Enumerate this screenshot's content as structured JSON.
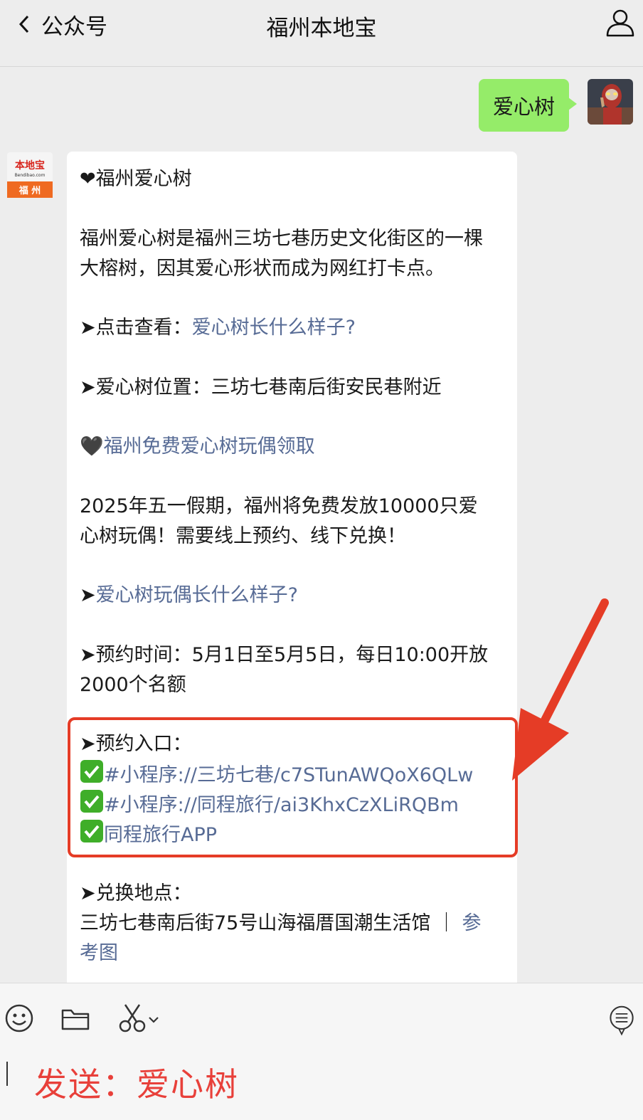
{
  "nav": {
    "back_label": "公众号",
    "title": "福州本地宝"
  },
  "outgoing": {
    "text": "爱心树"
  },
  "official_avatar": {
    "top_text": "本地宝",
    "sub_text": "Bendibao.com",
    "city_text": "福 州"
  },
  "message": {
    "heading": "❤福州爱心树",
    "intro_1": "福州爱心树是福州三坊七巷历史文化街区的一棵",
    "intro_2": "大榕树，因其爱心形状而成为网红打卡点。",
    "view_prefix": "➤点击查看：",
    "view_link": "爱心树长什么样子?",
    "location": "➤爱心树位置：三坊七巷南后街安民巷附近",
    "free_heart": "🖤",
    "free_link": "福州免费爱心树玩偶领取",
    "release_1": "2025年五一假期，福州将免费发放10000只爱",
    "release_2": "心树玩偶！需要线上预约、线下兑换！",
    "doll_prefix": "➤",
    "doll_link": "爱心树玩偶长什么样子?",
    "time_1": "➤预约时间：5月1日至5月5日，每日10:00开放",
    "time_2": "2000个名额",
    "entry_label": "➤预约入口：",
    "entry_1": "#小程序://三坊七巷/c7STunAWQoX6QLw",
    "entry_2": "#小程序://同程旅行/ai3KhxCzXLiRQBm",
    "entry_3": "同程旅行APP",
    "exchange_label": "➤兑换地点：",
    "exchange_addr": "三坊七巷南后街75号山海福厝国潮生活馆 ｜ ",
    "exchange_link_1": "参",
    "exchange_link_2": "考图"
  },
  "input": {
    "text": "发送：爱心树"
  },
  "colors": {
    "link": "#576b95",
    "outgoing_bubble": "#95ec69",
    "highlight": "#e53c26",
    "check": "#3fae29"
  }
}
